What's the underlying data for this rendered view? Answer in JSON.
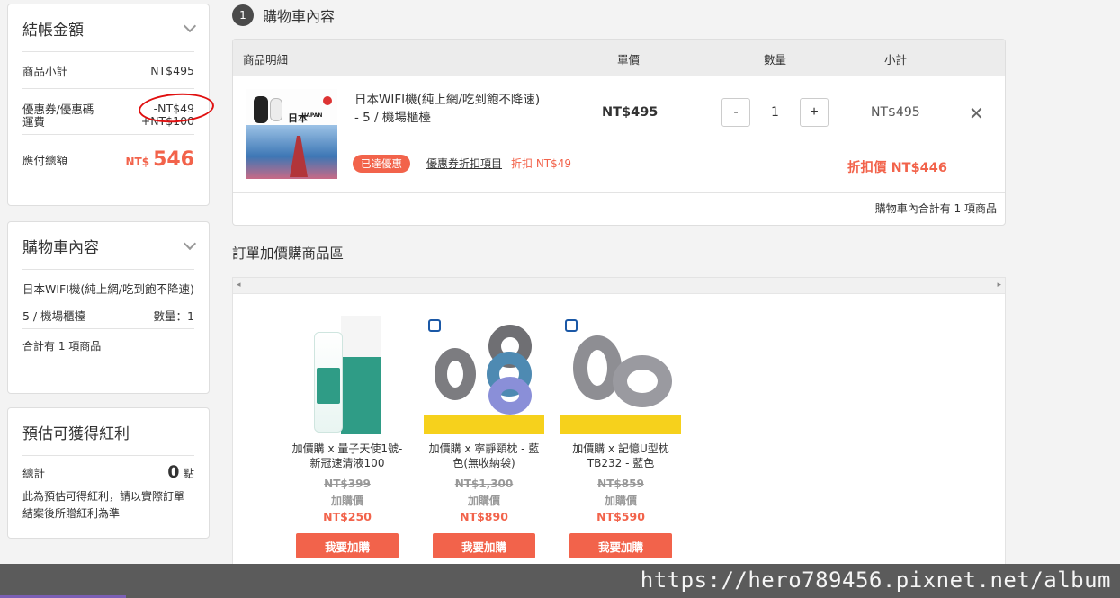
{
  "summary": {
    "title": "結帳金額",
    "subtotal_label": "商品小計",
    "subtotal_value": "NT$495",
    "coupon_label": "優惠券/優惠碼",
    "coupon_value": "-NT$49",
    "shipping_label": "運費",
    "shipping_value": "+NT$100",
    "total_label": "應付總額",
    "total_currency": "NT$",
    "total_amount": "546",
    "annotation_color": "#e01010"
  },
  "cart_summary": {
    "title": "購物車內容",
    "item_name": "日本WIFI機(純上網/吃到飽不降速)",
    "item_option": "5 / 機場櫃檯",
    "qty_text": "數量：1",
    "count_text": "合計有 1 項商品"
  },
  "bonus": {
    "title": "預估可獲得紅利",
    "total_label": "總計",
    "points_value": "0",
    "points_unit": "點",
    "note": "此為預估可得紅利，請以實際訂單結案後所贈紅利為準"
  },
  "cart": {
    "step_number": "1",
    "step_title": "購物車內容",
    "col_item": "商品明細",
    "col_price": "單價",
    "col_qty": "數量",
    "col_subtotal": "小計",
    "item": {
      "name": "日本WIFI機(純上網/吃到飽不降速) - 5 / 機場櫃檯",
      "thumb_text": "日本",
      "thumb_small_text": "JAPAN",
      "badge": "已達優惠",
      "coupon_link": "優惠券折扣項目",
      "discount_note": "折扣 NT$49",
      "unit_price": "NT$495",
      "minus": "-",
      "qty": "1",
      "plus": "+",
      "subtotal": "NT$495",
      "remove": "✕",
      "discount_price": "折扣價 NT$446"
    },
    "footer": "購物車內合計有 1 項商品"
  },
  "addons": {
    "title": "訂單加價購商品區",
    "scroll_left": "◂",
    "scroll_right": "▸",
    "products": [
      {
        "name": "加價購 x 量子天使1號-新冠速清液100",
        "orig": "NT$399",
        "label": "加購價",
        "price": "NT$250",
        "button": "我要加購"
      },
      {
        "name": "加價購 x 寧靜頸枕 - 藍色(無收納袋)",
        "orig": "NT$1,300",
        "label": "加購價",
        "price": "NT$890",
        "button": "我要加購"
      },
      {
        "name": "加價購 x 記憶U型枕 TB232 - 藍色",
        "orig": "NT$859",
        "label": "加購價",
        "price": "NT$590",
        "button": "我要加購"
      }
    ]
  },
  "watermark": "https://hero789456.pixnet.net/album",
  "colors": {
    "accent": "#f2634b",
    "header_bg": "#ececec",
    "watermark_bg": "#5b5b5b"
  }
}
